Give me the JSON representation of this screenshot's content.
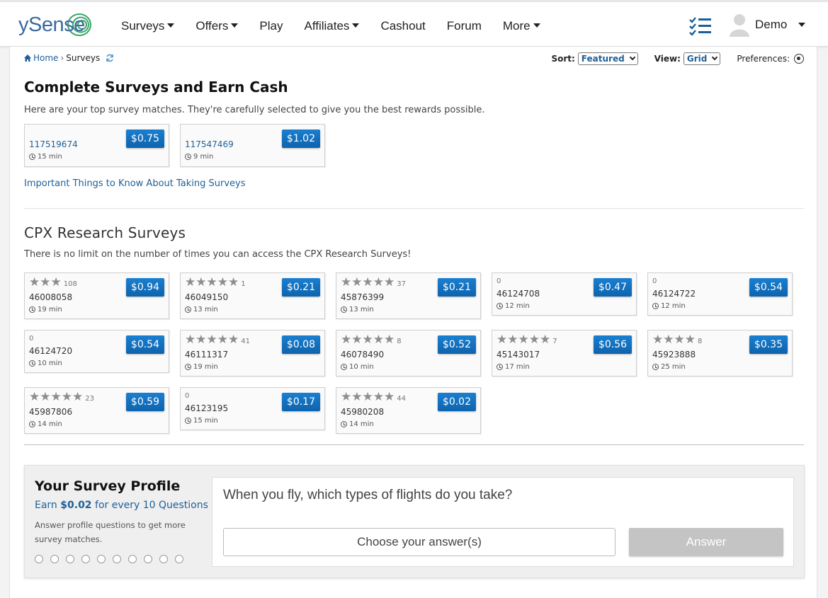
{
  "header": {
    "logo": "ySense",
    "nav": [
      {
        "label": "Surveys",
        "caret": true
      },
      {
        "label": "Offers",
        "caret": true
      },
      {
        "label": "Play",
        "caret": false
      },
      {
        "label": "Affiliates",
        "caret": true
      },
      {
        "label": "Cashout",
        "caret": false
      },
      {
        "label": "Forum",
        "caret": false
      },
      {
        "label": "More",
        "caret": true
      }
    ],
    "user_name": "Demo"
  },
  "breadcrumb": {
    "home": "Home",
    "sep": "›",
    "current": "Surveys"
  },
  "controls": {
    "sort_label": "Sort:",
    "sort_value": "Featured",
    "view_label": "View:",
    "view_value": "Grid",
    "preferences_label": "Preferences:"
  },
  "top_section": {
    "title": "Complete Surveys and Earn Cash",
    "desc": "Here are your top survey matches. They're carefully selected to give you the best rewards possible.",
    "cards": [
      {
        "id": "117519674",
        "time": "15 min",
        "price": "$0.75"
      },
      {
        "id": "117547469",
        "time": "9 min",
        "price": "$1.02"
      }
    ],
    "link": "Important Things to Know About Taking Surveys"
  },
  "cpx_section": {
    "title": "CPX Research Surveys",
    "desc": "There is no limit on the number of times you can access the CPX Research Surveys!",
    "cards": [
      {
        "id": "46008058",
        "time": "19 min",
        "price": "$0.94",
        "stars": "★★★",
        "count": "108"
      },
      {
        "id": "46049150",
        "time": "13 min",
        "price": "$0.21",
        "stars": "★★★★★",
        "count": "1"
      },
      {
        "id": "45876399",
        "time": "13 min",
        "price": "$0.21",
        "stars": "★★★★★",
        "count": "37"
      },
      {
        "id": "46124708",
        "time": "12 min",
        "price": "$0.47",
        "stars": "",
        "count": "0"
      },
      {
        "id": "46124722",
        "time": "12 min",
        "price": "$0.54",
        "stars": "",
        "count": "0"
      },
      {
        "id": "46124720",
        "time": "10 min",
        "price": "$0.54",
        "stars": "",
        "count": "0"
      },
      {
        "id": "46111317",
        "time": "19 min",
        "price": "$0.08",
        "stars": "★★★★★",
        "count": "41"
      },
      {
        "id": "46078490",
        "time": "10 min",
        "price": "$0.52",
        "stars": "★★★★★",
        "count": "8"
      },
      {
        "id": "45143017",
        "time": "17 min",
        "price": "$0.56",
        "stars": "★★★★★",
        "count": "7"
      },
      {
        "id": "45923888",
        "time": "25 min",
        "price": "$0.35",
        "stars": "★★★★",
        "count": "8"
      },
      {
        "id": "45987806",
        "time": "14 min",
        "price": "$0.59",
        "stars": "★★★★★",
        "count": "23"
      },
      {
        "id": "46123195",
        "time": "15 min",
        "price": "$0.17",
        "stars": "",
        "count": "0"
      },
      {
        "id": "45980208",
        "time": "14 min",
        "price": "$0.02",
        "stars": "★★★★★",
        "count": "44"
      }
    ]
  },
  "profile": {
    "title": "Your Survey Profile",
    "earn_prefix": "Earn ",
    "earn_amount": "$0.02",
    "earn_suffix": " for every 10 Questions",
    "note": "Answer profile questions to get more survey matches.",
    "progress_answered": 0,
    "progress_total": 10,
    "question": "When you fly, which types of flights do you take?",
    "choose_label": "Choose your answer(s)",
    "answer_label": "Answer"
  }
}
